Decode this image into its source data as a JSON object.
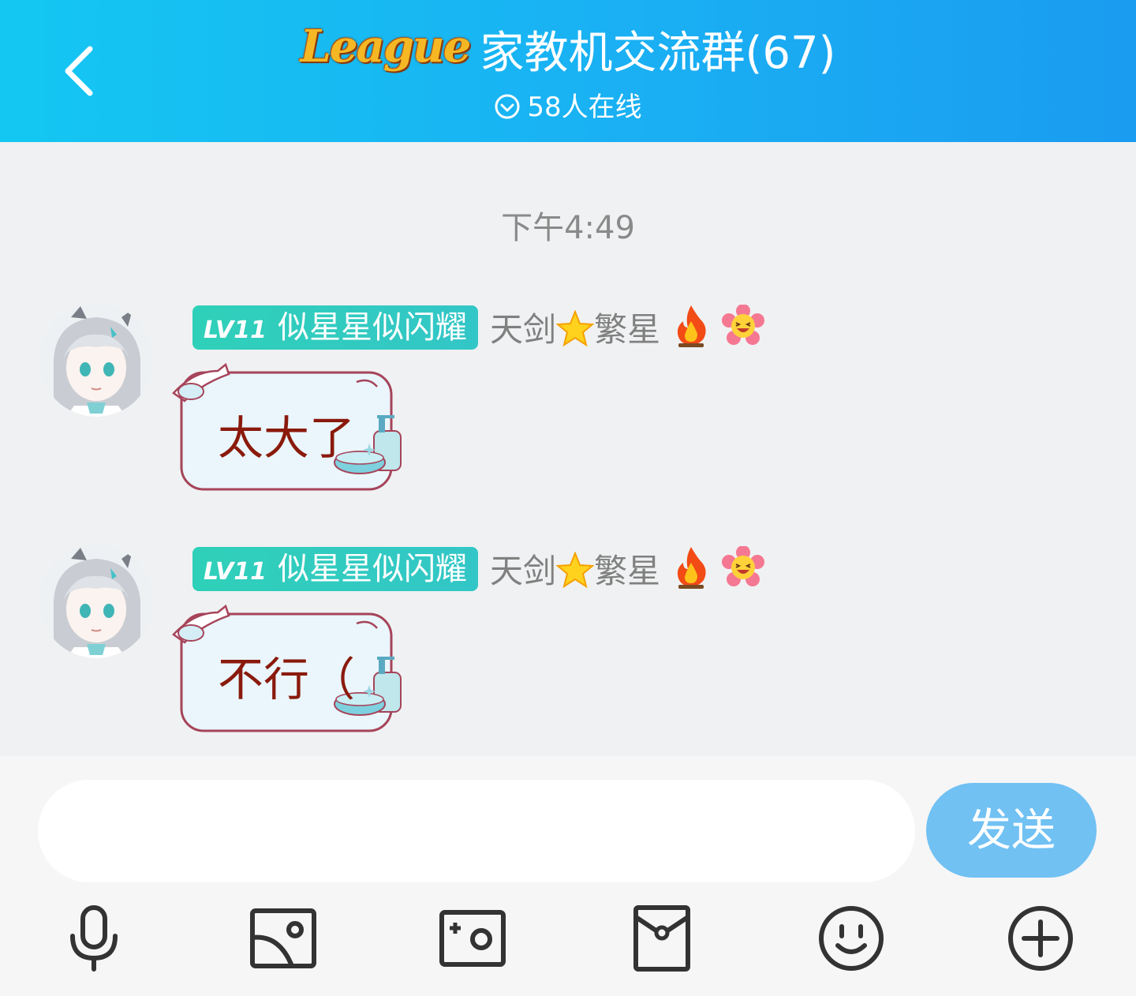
{
  "header": {
    "back_icon": "chevron-left-icon",
    "logo_text": "League",
    "group_name": "家教机交流群(67)",
    "online_text": "58人在线",
    "online_icon": "check-circle-icon",
    "gradient_start": "#14c7f2",
    "gradient_end": "#1a9cf0"
  },
  "chat": {
    "timestamp": "下午4:49",
    "messages": [
      {
        "level": "LV11",
        "title": "似星星似闪耀",
        "nickname_prefix": "天剑",
        "nickname_suffix": "繁星",
        "emojis": [
          "star-emoji",
          "fire-emoji",
          "flower-smile-emoji"
        ],
        "text": "太大了"
      },
      {
        "level": "LV11",
        "title": "似星星似闪耀",
        "nickname_prefix": "天剑",
        "nickname_suffix": "繁星",
        "emojis": [
          "star-emoji",
          "fire-emoji",
          "flower-smile-emoji"
        ],
        "text": "不行（"
      }
    ],
    "badge_color": "#2fd0b9",
    "bubble_text_color": "#8a1a0c"
  },
  "input": {
    "placeholder": "",
    "send_label": "发送",
    "send_color": "#71c1f3"
  },
  "toolbar": {
    "icons": [
      "microphone-icon",
      "image-icon",
      "camera-icon",
      "red-packet-icon",
      "smiley-icon",
      "plus-icon"
    ]
  }
}
